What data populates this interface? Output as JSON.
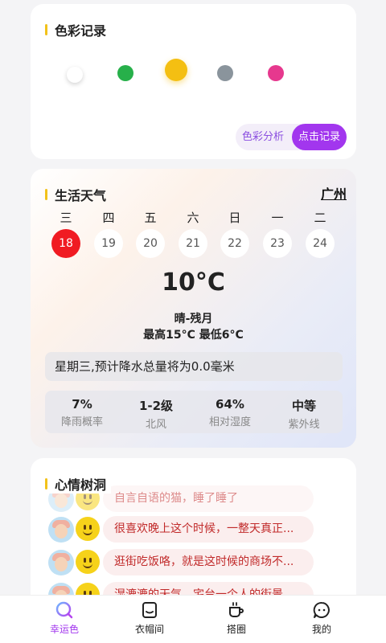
{
  "color_record": {
    "title": "色彩记录",
    "dots": [
      {
        "name": "white",
        "color": "#ffffff"
      },
      {
        "name": "green",
        "color": "#27b04a"
      },
      {
        "name": "yellow",
        "color": "#f4bf12"
      },
      {
        "name": "gray",
        "color": "#8a949c"
      },
      {
        "name": "pink",
        "color": "#e6388e"
      }
    ],
    "analysis_label": "色彩分析",
    "record_label": "点击记录"
  },
  "weather": {
    "title": "生活天气",
    "city": "广州",
    "weekdays": [
      "三",
      "四",
      "五",
      "六",
      "日",
      "一",
      "二"
    ],
    "dates": [
      "18",
      "19",
      "20",
      "21",
      "22",
      "23",
      "24"
    ],
    "active_date": "18",
    "temperature": "10°C",
    "condition": "晴-残月",
    "range": "最高15°C 最低6°C",
    "forecast": "星期三,预计降水总量将为0.0毫米",
    "stats": [
      {
        "value": "7%",
        "label": "降雨概率"
      },
      {
        "value": "1-2级",
        "label": "北风"
      },
      {
        "value": "64%",
        "label": "相对湿度"
      },
      {
        "value": "中等",
        "label": "紫外线"
      }
    ]
  },
  "mood": {
    "title": "心情树洞",
    "messages": [
      "自言自语的猫，睡了睡了",
      "很喜欢晚上这个时候，一整天真正...",
      "逛街吃饭咯，就是这时候的商场不...",
      "湿漉漉的天气，宅台一个人的街景"
    ]
  },
  "tabs": [
    {
      "label": "幸运色",
      "icon": "lucky-color-icon",
      "active": true
    },
    {
      "label": "衣帽间",
      "icon": "wardrobe-icon",
      "active": false
    },
    {
      "label": "搭圈",
      "icon": "coffee-cup-icon",
      "active": false
    },
    {
      "label": "我的",
      "icon": "chat-bubble-icon",
      "active": false
    }
  ],
  "colors": {
    "accent": "#a236ee",
    "active_date": "#f01b22",
    "section_bar": "#f2c21a",
    "mood_text": "#c12a2a"
  }
}
